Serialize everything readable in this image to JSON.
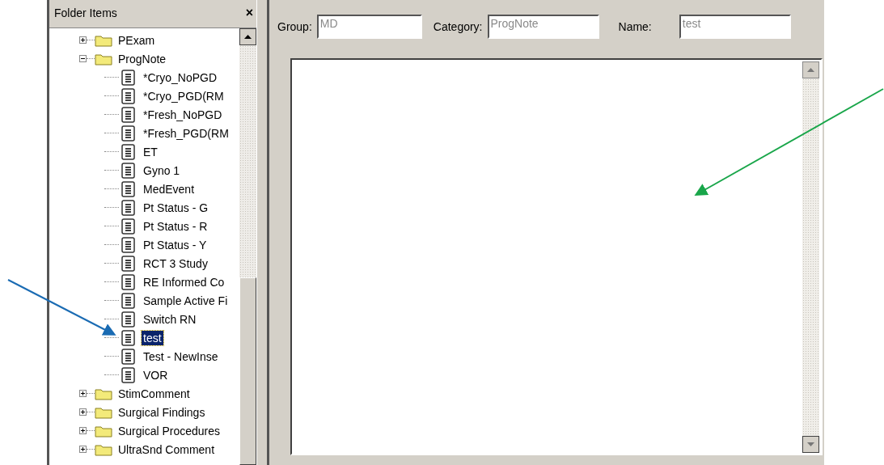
{
  "panel": {
    "title": "Folder Items",
    "close": "×"
  },
  "tree": [
    {
      "label": "PExam",
      "expanded": false,
      "selected": false
    },
    {
      "label": "ProgNote",
      "expanded": true,
      "selected": false,
      "children": [
        {
          "label": "*Cryo_NoPGD",
          "selected": false
        },
        {
          "label": "*Cryo_PGD(RM",
          "selected": false
        },
        {
          "label": "*Fresh_NoPGD",
          "selected": false
        },
        {
          "label": "*Fresh_PGD(RM",
          "selected": false
        },
        {
          "label": "ET",
          "selected": false
        },
        {
          "label": "Gyno 1",
          "selected": false
        },
        {
          "label": "MedEvent",
          "selected": false
        },
        {
          "label": "Pt Status - G",
          "selected": false
        },
        {
          "label": "Pt Status - R",
          "selected": false
        },
        {
          "label": "Pt Status - Y",
          "selected": false
        },
        {
          "label": "RCT 3 Study",
          "selected": false
        },
        {
          "label": "RE Informed Co",
          "selected": false
        },
        {
          "label": "Sample Active Fi",
          "selected": false
        },
        {
          "label": "Switch RN",
          "selected": false
        },
        {
          "label": "test",
          "selected": true
        },
        {
          "label": "Test - NewInse",
          "selected": false
        },
        {
          "label": "VOR",
          "selected": false
        }
      ]
    },
    {
      "label": "StimComment",
      "expanded": false,
      "selected": false
    },
    {
      "label": "Surgical Findings",
      "expanded": false,
      "selected": false
    },
    {
      "label": "Surgical Procedures",
      "expanded": false,
      "selected": false
    },
    {
      "label": "UltraSnd Comment",
      "expanded": false,
      "selected": false
    }
  ],
  "fields": [
    {
      "label": "Group:",
      "value": "MD",
      "disabled": true
    },
    {
      "label": "Category:",
      "value": "ProgNote",
      "disabled": true
    },
    {
      "label": "Name:",
      "value": "test",
      "disabled": true
    }
  ]
}
